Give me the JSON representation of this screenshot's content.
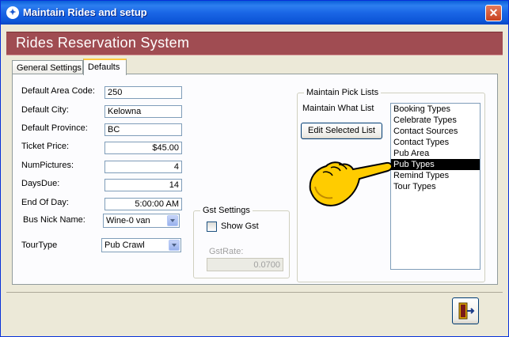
{
  "window": {
    "title": "Maintain Rides and setup",
    "close_glyph": "✕"
  },
  "banner": {
    "text": "Rides Reservation  System"
  },
  "tabs": [
    {
      "label": "General Settings",
      "active": false
    },
    {
      "label": "Defaults",
      "active": true
    }
  ],
  "fields": {
    "area_code": {
      "label": "Default Area Code:",
      "value": "250"
    },
    "city": {
      "label": "Default City:",
      "value": "Kelowna"
    },
    "province": {
      "label": "Default Province:",
      "value": "BC"
    },
    "ticket_price": {
      "label": "Ticket Price:",
      "value": "$45.00"
    },
    "num_pictures": {
      "label": "NumPictures:",
      "value": "4"
    },
    "days_due": {
      "label": "DaysDue:",
      "value": "14"
    },
    "end_of_day": {
      "label": "End Of Day:",
      "value": "5:00:00 AM"
    },
    "bus_nick_name": {
      "label": "Bus Nick Name:",
      "value": "Wine-0 van"
    },
    "tour_type": {
      "label": "TourType",
      "value": "Pub Crawl"
    }
  },
  "gst": {
    "group_title": "Gst Settings",
    "show_gst_label": "Show Gst",
    "show_gst_checked": false,
    "rate_label": "GstRate:",
    "rate_value": "0.0700"
  },
  "pick_lists": {
    "group_title": "Maintain Pick Lists",
    "what_list_label": "Maintain What List",
    "edit_button_label": "Edit Selected List",
    "items": [
      "Booking Types",
      "Celebrate Types",
      "Contact Sources",
      "Contact Types",
      "Pub Area",
      "Pub Types",
      "Remind Types",
      "Tour Types"
    ],
    "selected": "Pub Types"
  },
  "colors": {
    "titlebar": "#0a5fd8",
    "banner": "#a04c52",
    "selection": "#000000",
    "hand": "#ffcc00"
  },
  "icons": {
    "exit": "exit-door-icon",
    "pointer": "pointing-hand-icon",
    "app": "app-icon"
  }
}
